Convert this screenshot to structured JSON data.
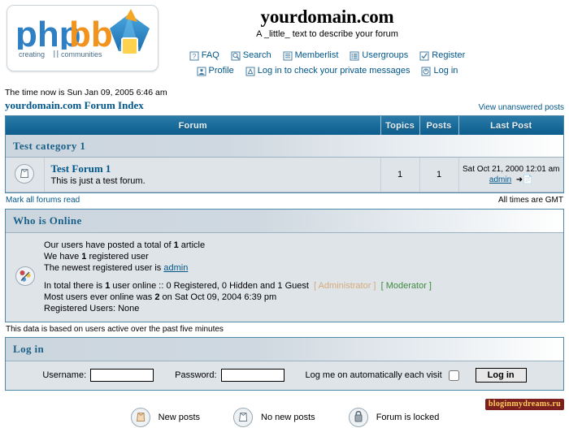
{
  "header": {
    "logo_alt": "phpBB - creating communities",
    "logo_text_php": "php",
    "logo_text_bb": "bb",
    "logo_tagline": "creating communities",
    "site_title": "yourdomain.com",
    "site_description": "A _little_ text to describe your forum",
    "nav_row1": [
      {
        "icon": "faq-icon",
        "label": "FAQ"
      },
      {
        "icon": "search-icon",
        "label": "Search"
      },
      {
        "icon": "memberlist-icon",
        "label": "Memberlist"
      },
      {
        "icon": "usergroups-icon",
        "label": "Usergroups"
      },
      {
        "icon": "register-icon",
        "label": "Register"
      }
    ],
    "nav_row2": [
      {
        "icon": "profile-icon",
        "label": "Profile"
      },
      {
        "icon": "private-messages-icon",
        "label": "Log in to check your private messages"
      },
      {
        "icon": "login-icon",
        "label": "Log in"
      }
    ]
  },
  "status": {
    "time_now": "The time now is Sun Jan 09, 2005 6:46 am",
    "forum_index_link": "yourdomain.com Forum Index",
    "view_unanswered": "View unanswered posts"
  },
  "forum_table": {
    "columns": [
      "Forum",
      "Topics",
      "Posts",
      "Last Post"
    ],
    "categories": [
      {
        "name": "Test category 1",
        "forums": [
          {
            "icon": "no-new-posts-icon",
            "title": "Test Forum 1",
            "description": "This is just a test forum.",
            "topics": "1",
            "posts": "1",
            "last_post_date": "Sat Oct 21, 2000 12:01 am",
            "last_post_user": "admin"
          }
        ]
      }
    ],
    "mark_all_read": "Mark all forums read",
    "timezone": "All times are GMT"
  },
  "who_is_online": {
    "title": "Who is Online",
    "icon": "who-is-online-icon",
    "stat_total_prefix": "Our users have posted a total of ",
    "stat_total_count": "1",
    "stat_total_suffix": " article",
    "registered_prefix": "We have ",
    "registered_count": "1",
    "registered_suffix": " registered user",
    "newest_prefix": "The newest registered user is ",
    "newest_user": "admin",
    "online_prefix": "In total there is ",
    "online_count": "1",
    "online_middle": " user online :: 0 Registered, 0 Hidden and 1 Guest",
    "role_admin": "[ Administrator ]",
    "role_mod": "[ Moderator ]",
    "record_prefix": "Most users ever online was ",
    "record_count": "2",
    "record_suffix": " on Sat Oct 09, 2004 6:39 pm",
    "registered_users_line": "Registered Users: None",
    "note": "This data is based on users active over the past five minutes"
  },
  "login": {
    "title": "Log in",
    "username_label": "Username:",
    "username_value": "",
    "username_placeholder": "",
    "password_label": "Password:",
    "password_value": "",
    "password_placeholder": "",
    "autologin_label": "Log me on automatically each visit",
    "autologin_checked": false,
    "submit_label": "Log in"
  },
  "legend": [
    {
      "icon": "new-posts-icon",
      "label": "New posts"
    },
    {
      "icon": "no-new-posts-icon",
      "label": "No new posts"
    },
    {
      "icon": "forum-locked-icon",
      "label": "Forum is locked"
    }
  ],
  "watermark": {
    "text": "bloginmydreams.ru"
  },
  "colors": {
    "header_blue": "#1b6d9c",
    "link_blue": "#005689",
    "panel_border": "#4f8aab",
    "row_bg": "#dfe4e9",
    "cat_bg": "#ccd6de",
    "admin_role": "#d6ab7a",
    "mod_role": "#3f8a3f"
  }
}
